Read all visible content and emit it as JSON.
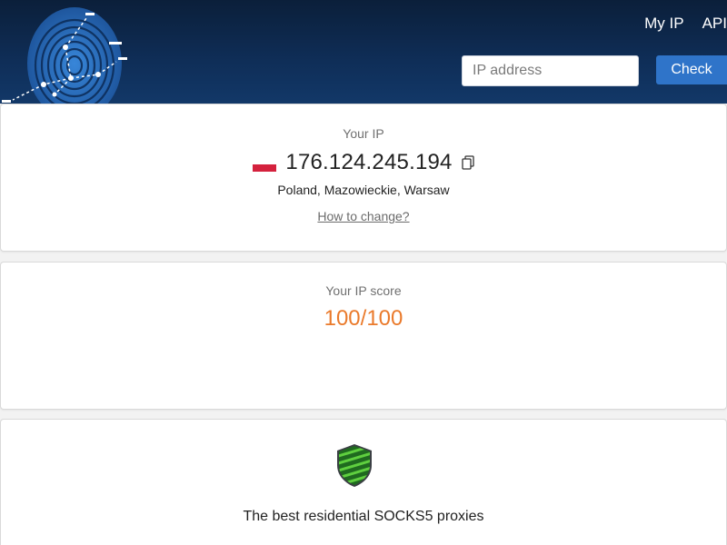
{
  "header": {
    "nav": [
      {
        "label": "My IP"
      },
      {
        "label": "API"
      }
    ],
    "search": {
      "placeholder": "IP address",
      "value": ""
    },
    "check_label": "Check",
    "logo_icon": "fingerprint-icon"
  },
  "ip_card": {
    "label": "Your IP",
    "ip": "176.124.245.194",
    "flag_icon": "poland-flag-icon",
    "location": "Poland, Mazowieckie, Warsaw",
    "how_link": "How to change?"
  },
  "score_card": {
    "label": "Your IP score",
    "score": "100/100",
    "score_color": "#ea7a2b"
  },
  "proxy_card": {
    "shield_icon": "shield-icon",
    "text": "The best residential SOCKS5 proxies"
  },
  "colors": {
    "header_bg": "#0f2e58",
    "accent": "#2f74c9",
    "score": "#ea7a2b"
  }
}
